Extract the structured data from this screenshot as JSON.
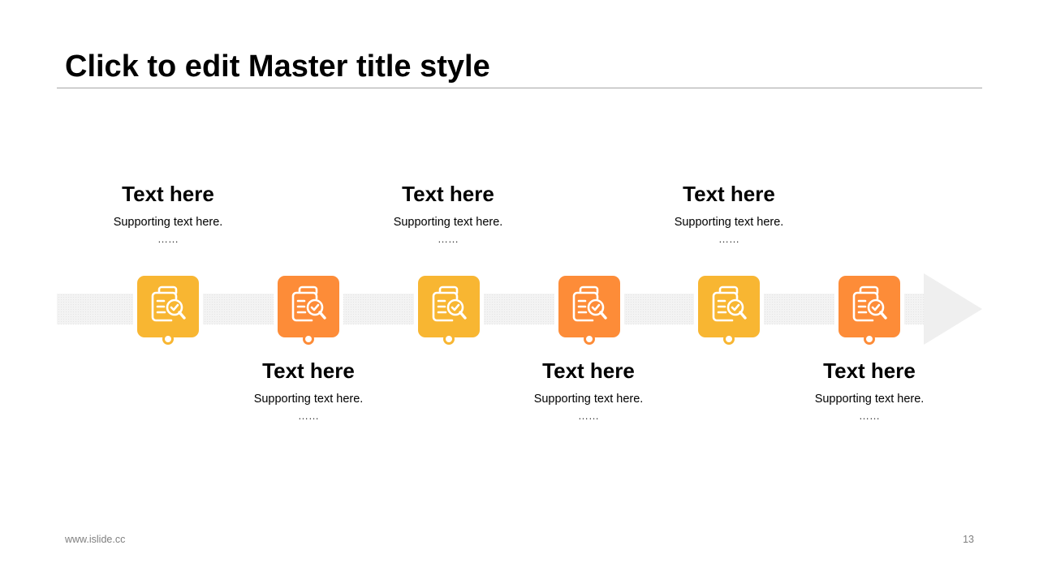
{
  "slide": {
    "title": "Click to edit Master title style",
    "footer_url": "www.islide.cc",
    "page_number": "13"
  },
  "colors": {
    "yellow": "#F8B632",
    "orange": "#FD8C38",
    "arrow": "#efefef",
    "rule": "#a6a6a6"
  },
  "steps": [
    {
      "heading": "Text here",
      "support": "Supporting text here.",
      "dots": "……",
      "color": "yellow",
      "position": "above",
      "icon": "document-search-check-icon"
    },
    {
      "heading": "Text here",
      "support": "Supporting text here.",
      "dots": "……",
      "color": "orange",
      "position": "below",
      "icon": "document-search-check-icon"
    },
    {
      "heading": "Text here",
      "support": "Supporting text here.",
      "dots": "……",
      "color": "yellow",
      "position": "above",
      "icon": "document-search-check-icon"
    },
    {
      "heading": "Text here",
      "support": "Supporting text here.",
      "dots": "……",
      "color": "orange",
      "position": "below",
      "icon": "document-search-check-icon"
    },
    {
      "heading": "Text here",
      "support": "Supporting text here.",
      "dots": "……",
      "color": "yellow",
      "position": "above",
      "icon": "document-search-check-icon"
    },
    {
      "heading": "Text here",
      "support": "Supporting text here.",
      "dots": "……",
      "color": "orange",
      "position": "below",
      "icon": "document-search-check-icon"
    }
  ]
}
